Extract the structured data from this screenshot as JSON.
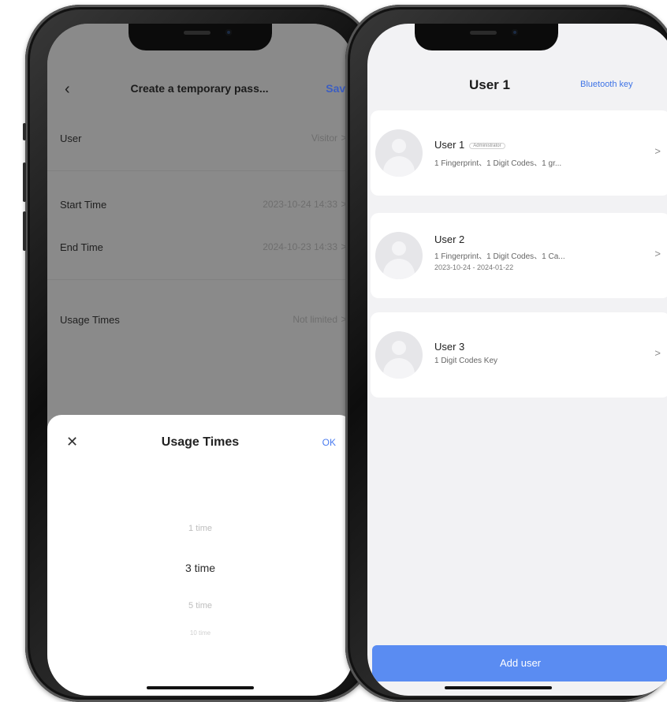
{
  "left_screen": {
    "nav": {
      "back_glyph": "‹",
      "title": "Create a temporary pass...",
      "save_label": "Save"
    },
    "rows": [
      {
        "label": "User",
        "value": "Visitor"
      },
      {
        "label": "Start Time",
        "value": "2023-10-24 14:33"
      },
      {
        "label": "End Time",
        "value": "2024-10-23 14:33"
      },
      {
        "label": "Usage Times",
        "value": "Not limited"
      }
    ],
    "chevron": ">",
    "sheet": {
      "close_glyph": "✕",
      "title": "Usage Times",
      "ok_label": "OK",
      "options": [
        "1 time",
        "3 time",
        "5 time",
        "10 time"
      ],
      "selected": "3 time"
    }
  },
  "right_screen": {
    "title": "User 1",
    "bluetooth_key_label": "Bluetooth key",
    "users": [
      {
        "name": "User 1",
        "badge": "Administrator",
        "desc": "1 Fingerprint、1 Digit Codes、1 gr...",
        "date": ""
      },
      {
        "name": "User 2",
        "badge": "",
        "desc": "1 Fingerprint、1 Digit Codes、1 Ca...",
        "date": "2023-10-24 - 2024-01-22"
      },
      {
        "name": "User 3",
        "badge": "",
        "desc": "1 Digit Codes Key",
        "date": ""
      }
    ],
    "chevron": ">",
    "add_user_label": "Add user"
  },
  "colors": {
    "accent_blue": "#5a8cf2",
    "link_blue": "#3f74e6",
    "overlay_gray": "#8a8a8a",
    "phone_frame": "#1a1a1a"
  },
  "icons": [
    "back-chevron-icon",
    "chevron-right-icon",
    "close-icon",
    "avatar-placeholder-icon"
  ]
}
